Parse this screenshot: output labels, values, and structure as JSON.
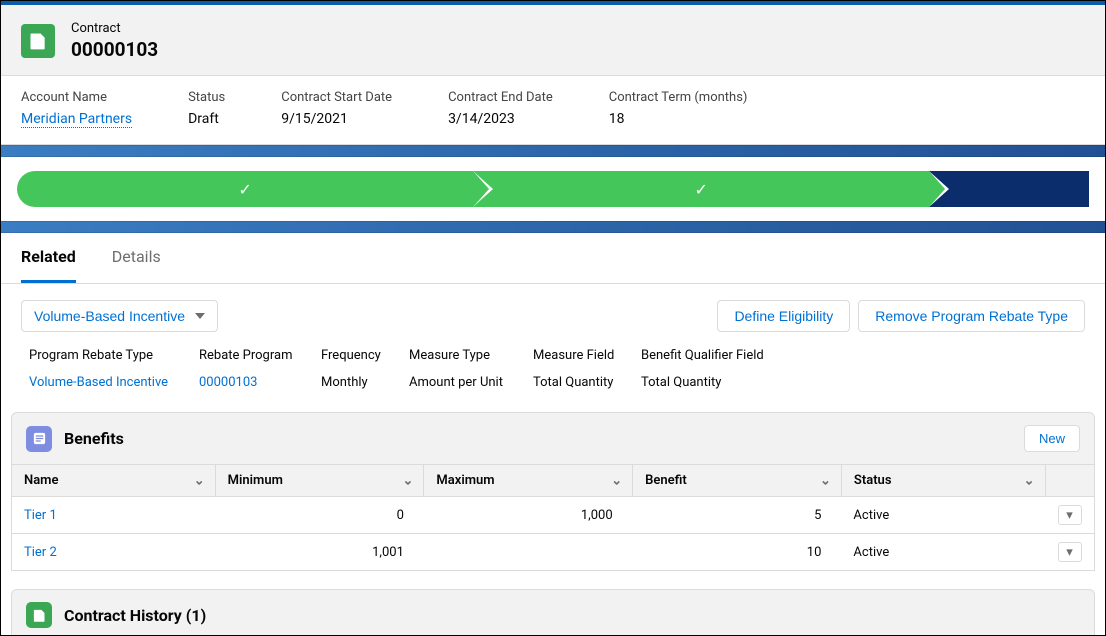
{
  "header": {
    "record_type": "Contract",
    "record_number": "00000103"
  },
  "highlights": {
    "account_label": "Account Name",
    "account_value": "Meridian Partners",
    "status_label": "Status",
    "status_value": "Draft",
    "start_label": "Contract Start Date",
    "start_value": "9/15/2021",
    "end_label": "Contract End Date",
    "end_value": "3/14/2023",
    "term_label": "Contract Term (months)",
    "term_value": "18"
  },
  "tabs": {
    "related": "Related",
    "details": "Details"
  },
  "incentive_picker": "Volume-Based Incentive",
  "buttons": {
    "define_eligibility": "Define Eligibility",
    "remove_rebate": "Remove Program Rebate Type",
    "new": "New"
  },
  "detail_fields": {
    "program_rebate_type_label": "Program Rebate Type",
    "program_rebate_type_value": "Volume-Based Incentive",
    "rebate_program_label": "Rebate Program",
    "rebate_program_value": "00000103",
    "frequency_label": "Frequency",
    "frequency_value": "Monthly",
    "measure_type_label": "Measure Type",
    "measure_type_value": "Amount per Unit",
    "measure_field_label": "Measure Field",
    "measure_field_value": "Total Quantity",
    "benefit_qualifier_label": "Benefit Qualifier Field",
    "benefit_qualifier_value": "Total Quantity"
  },
  "benefits": {
    "title": "Benefits",
    "columns": {
      "name": "Name",
      "minimum": "Minimum",
      "maximum": "Maximum",
      "benefit": "Benefit",
      "status": "Status"
    },
    "rows": [
      {
        "name": "Tier 1",
        "min": "0",
        "max": "1,000",
        "benefit": "5",
        "status": "Active"
      },
      {
        "name": "Tier 2",
        "min": "1,001",
        "max": "",
        "benefit": "10",
        "status": "Active"
      }
    ]
  },
  "history": {
    "title": "Contract History (1)"
  }
}
